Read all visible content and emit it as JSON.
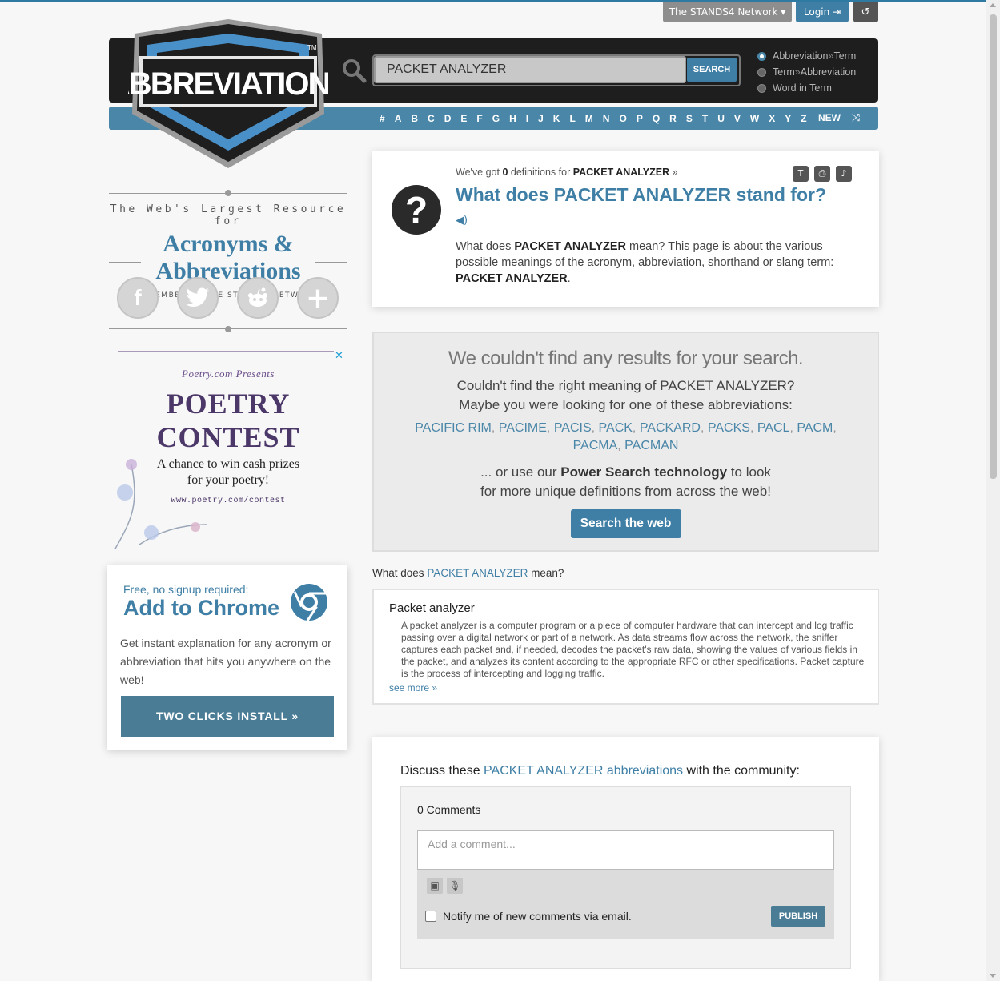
{
  "topnav": {
    "network_label": "The STANDS4 Network ▾",
    "login_label": "Login ⇥",
    "history_icon": "history-icon"
  },
  "logo": {
    "text": "ABBREVIATIONS",
    "tm": "TM"
  },
  "search": {
    "value": "PACKET ANALYZER",
    "button_label": "SEARCH",
    "options": [
      {
        "part1": "Abbreviation",
        "sep": " » ",
        "part2": "Term",
        "selected": true
      },
      {
        "part1": "Term",
        "sep": " » ",
        "part2": "Abbreviation",
        "selected": false
      },
      {
        "part1": "Word in Term",
        "sep": "",
        "part2": "",
        "selected": false
      }
    ]
  },
  "alphabet": {
    "letters": [
      "#",
      "A",
      "B",
      "C",
      "D",
      "E",
      "F",
      "G",
      "H",
      "I",
      "J",
      "K",
      "L",
      "M",
      "N",
      "O",
      "P",
      "Q",
      "R",
      "S",
      "T",
      "U",
      "V",
      "W",
      "X",
      "Y",
      "Z"
    ],
    "new_label": "NEW"
  },
  "sidebar": {
    "tagline1": "The Web's Largest Resource for",
    "tagline2": "Acronyms & Abbreviations",
    "tagline3": "A MEMBER OF THE STANDS4 NETWORK",
    "social": [
      "facebook-icon",
      "twitter-icon",
      "reddit-icon",
      "plus-icon"
    ]
  },
  "ad": {
    "presents": "Poetry.com Presents",
    "title_line1": "POETRY",
    "title_line2": "CONTEST",
    "sub_line1": "A chance to win cash prizes",
    "sub_line2": "for your poetry!",
    "url": "www.poetry.com/contest"
  },
  "chrome": {
    "free": "Free, no signup required:",
    "title": "Add to Chrome",
    "desc": "Get instant explanation for any acronym or abbreviation that hits you anywhere on the web!",
    "button": "TWO CLICKS INSTALL »"
  },
  "definition": {
    "got_prefix": "We've got",
    "count": "0",
    "got_middle": "definitions for",
    "term": "PACKET ANALYZER",
    "got_suffix": "»",
    "title": "What does PACKET ANALYZER stand for?",
    "desc_pre": "What does",
    "desc_mid": "mean? This page is about the various possible meanings of the acronym, abbreviation, shorthand or slang term:",
    "desc_end": "."
  },
  "noresults": {
    "title": "We couldn't find any results for your search.",
    "line1": "Couldn't find the right meaning of PACKET ANALYZER?",
    "line2": "Maybe you were looking for one of these abbreviations:",
    "suggestions": [
      "PACIFIC RIM",
      "PACIME",
      "PACIS",
      "PACK",
      "PACKARD",
      "PACKS",
      "PACL",
      "PACM",
      "PACMA",
      "PACMAN"
    ],
    "power_pre": "... or use our",
    "power_bold": "Power Search technology",
    "power_post": "to look",
    "power_line2": "for more unique definitions from across the web!",
    "button": "Search the web"
  },
  "meaning": {
    "label_pre": "What does",
    "label_term": "PACKET ANALYZER",
    "label_post": "mean?",
    "title": "Packet analyzer",
    "desc": "A packet analyzer is a computer program or a piece of computer hardware that can intercept and log traffic passing over a digital network or part of a network. As data streams flow across the network, the sniffer captures each packet and, if needed, decodes the packet's raw data, showing the values of various fields in the packet, and analyzes its content according to the appropriate RFC or other specifications. Packet capture is the process of intercepting and logging traffic.",
    "more": "see more »"
  },
  "discuss": {
    "title_pre": "Discuss these",
    "title_link": "PACKET ANALYZER abbreviations",
    "title_post": "with the community:",
    "count": "0 Comments",
    "placeholder": "Add a comment...",
    "notify": "Notify me of new comments via email.",
    "publish": "PUBLISH"
  },
  "colors": {
    "accent": "#3f7fa6",
    "header": "#1e1e1e",
    "alpha_bar": "#4a86a8"
  }
}
